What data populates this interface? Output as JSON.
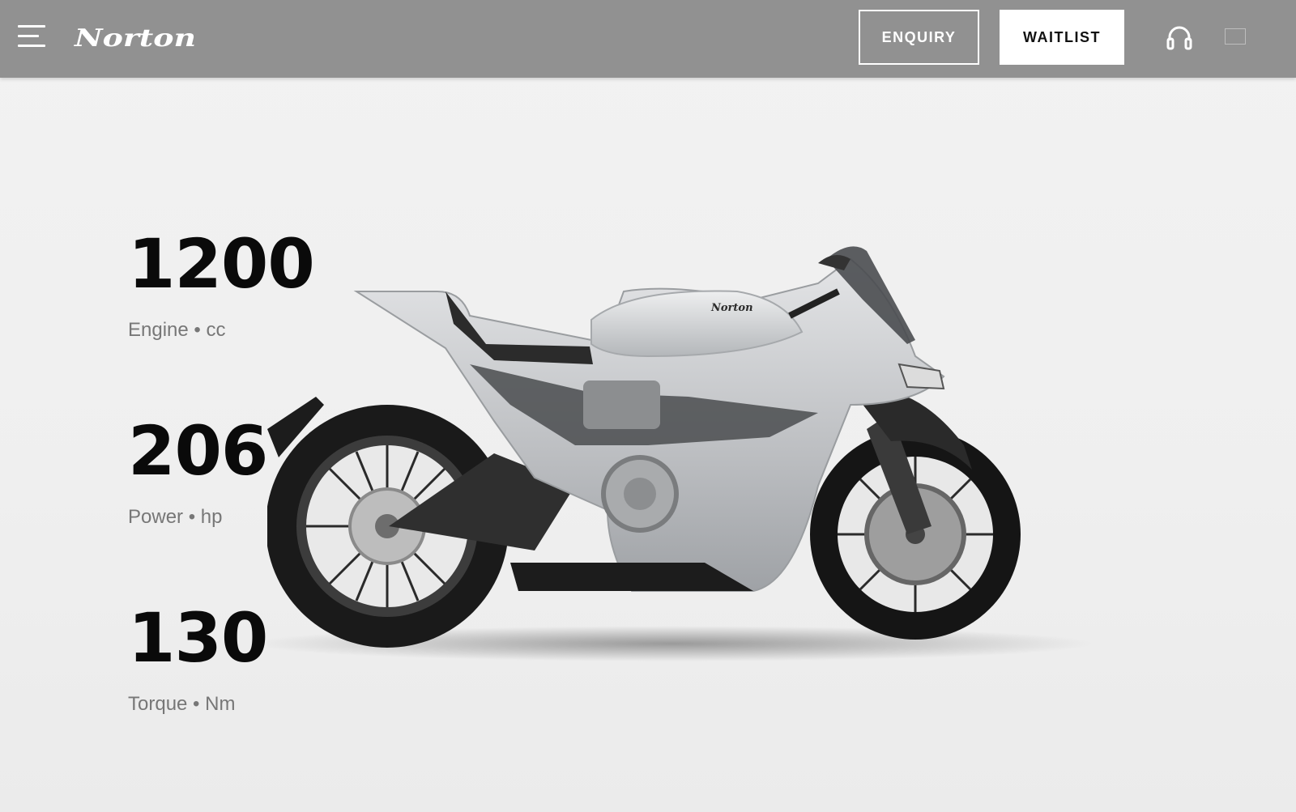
{
  "header": {
    "logo_text": "Norton",
    "enquiry_label": "ENQUIRY",
    "waitlist_label": "WAITLIST",
    "icons": [
      "menu-icon",
      "headset-icon",
      "cart-icon"
    ]
  },
  "specs": [
    {
      "value": "1200",
      "label": "Engine • cc"
    },
    {
      "value": "206",
      "label": "Power • hp"
    },
    {
      "value": "130",
      "label": "Torque • Nm"
    }
  ],
  "bike": {
    "tank_logo_text": "Norton"
  },
  "colors": {
    "header_bg": "#919191",
    "page_bg": "#f0f0f0",
    "text_primary": "#0a0a0a",
    "text_secondary": "#777777",
    "bike_body": "#c4c6c9"
  }
}
